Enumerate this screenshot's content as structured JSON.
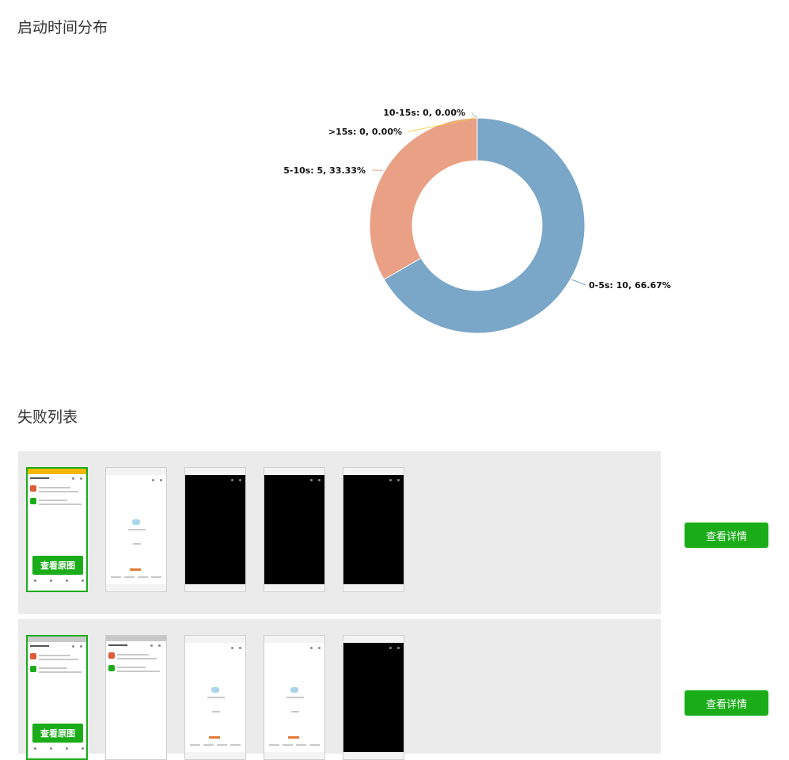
{
  "sections": {
    "distribution_title": "启动时间分布",
    "failures_title": "失败列表"
  },
  "chart_data": {
    "type": "pie",
    "variant": "donut",
    "categories": [
      "0-5s",
      "5-10s",
      ">15s",
      "10-15s"
    ],
    "values": [
      10,
      5,
      0,
      0
    ],
    "labels": [
      "0-5s: 10, 66.67%",
      "5-10s: 5, 33.33%",
      ">15s: 0, 0.00%",
      "10-15s: 0, 0.00%"
    ],
    "colors": [
      "#7aa6c8",
      "#e9a084",
      "#f2cf45",
      "#95c9b5"
    ]
  },
  "failures": [
    {
      "thumbnails": [
        "app-home",
        "splash",
        "black",
        "black",
        "black"
      ],
      "view_original_label": "查看原图",
      "detail_label": "查看详情"
    },
    {
      "thumbnails": [
        "app-home-grey",
        "app-home-grey",
        "splash",
        "splash",
        "black"
      ],
      "view_original_label": "查看原图",
      "detail_label": "查看详情"
    }
  ]
}
